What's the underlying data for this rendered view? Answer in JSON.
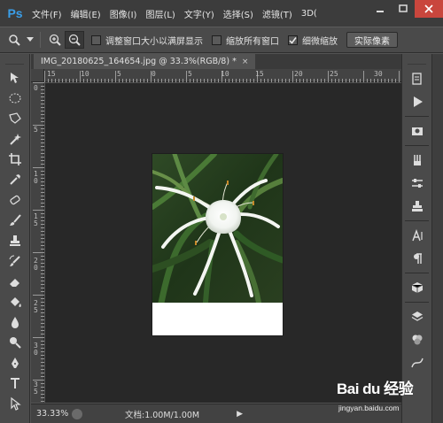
{
  "app": {
    "logo": "Ps"
  },
  "menu": [
    "文件(F)",
    "编辑(E)",
    "图像(I)",
    "图层(L)",
    "文字(Y)",
    "选择(S)",
    "滤镜(T)",
    "3D("
  ],
  "options": {
    "checkbox1_label": "调整窗口大小以满屏显示",
    "checkbox1_checked": false,
    "checkbox2_label": "缩放所有窗口",
    "checkbox2_checked": false,
    "checkbox3_label": "细微缩放",
    "checkbox3_checked": true,
    "actual_pixels_label": "实际像素"
  },
  "document": {
    "tab_title": "IMG_20180625_164654.jpg @ 33.3%(RGB/8) *",
    "close_glyph": "×"
  },
  "ruler_top": [
    "15",
    "10",
    "5",
    "0",
    "5",
    "10",
    "15",
    "20",
    "25",
    "30"
  ],
  "ruler_left": [
    "0",
    "5",
    "1 0",
    "1 5",
    "2 0",
    "2 5",
    "3 0",
    "3 5"
  ],
  "status": {
    "zoom": "33.33%",
    "doc_size": "文档:1.00M/1.00M",
    "arrow": "▶"
  },
  "watermark": {
    "logo": "Bai du 经验",
    "url": "jingyan.baidu.com"
  },
  "colors": {
    "menubar": "#3c3c3c",
    "panel": "#4a4a4a",
    "workspace": "#282828",
    "ps_blue": "#3a9ee8"
  }
}
